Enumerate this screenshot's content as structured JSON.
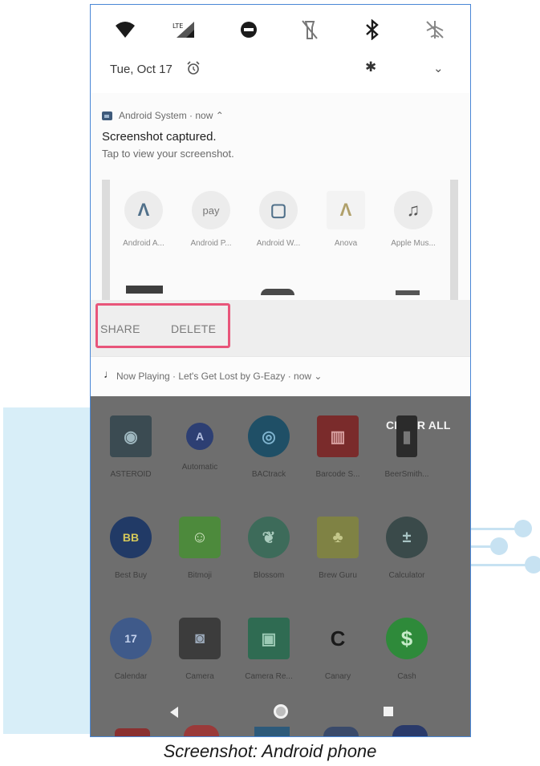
{
  "quick_settings": {
    "icons": [
      "wifi-icon",
      "lte-signal-icon",
      "do-not-disturb-icon",
      "flashlight-off-icon",
      "bluetooth-icon",
      "airplane-mode-off-icon"
    ],
    "lte_label": "LTE"
  },
  "date_row": {
    "date": "Tue, Oct 17",
    "alarm_icon": "alarm-icon",
    "settings_icon": "gear-icon",
    "expand_icon": "chevron-down-icon"
  },
  "notification": {
    "header": "Android System · now ⌃",
    "title": "Screenshot captured.",
    "subtitle": "Tap to view your screenshot.",
    "preview_apps": [
      {
        "label": "Android A...",
        "glyph": "Λ"
      },
      {
        "label": "Android P...",
        "glyph": "pay"
      },
      {
        "label": "Android W...",
        "glyph": "▢"
      },
      {
        "label": "Anova",
        "glyph": "Λ"
      },
      {
        "label": "Apple Mus...",
        "glyph": "♫"
      }
    ],
    "actions": {
      "share": "SHARE",
      "delete": "DELETE"
    }
  },
  "now_playing": {
    "text": "Now Playing · Let's Get Lost by G-Eazy · now ⌄"
  },
  "app_drawer": {
    "clear_all": "CLEAR ALL",
    "rows": [
      [
        {
          "label": "ASTEROID",
          "glyph": "◉",
          "color": "#3b4b52"
        },
        {
          "label": "Automatic",
          "glyph": "A",
          "color": "#2d3f73"
        },
        {
          "label": "BACtrack",
          "glyph": "◎",
          "color": "#1f4f66"
        },
        {
          "label": "Barcode S...",
          "glyph": "▥",
          "color": "#7a2b2b"
        },
        {
          "label": "BeerSmith...",
          "glyph": "▮",
          "color": "#2b2b2b"
        }
      ],
      [
        {
          "label": "Best Buy",
          "glyph": "BB",
          "color": "#213a66"
        },
        {
          "label": "Bitmoji",
          "glyph": "☺",
          "color": "#4d8a3c"
        },
        {
          "label": "Blossom",
          "glyph": "❦",
          "color": "#3d6b5a"
        },
        {
          "label": "Brew Guru",
          "glyph": "♣",
          "color": "#7f8244"
        },
        {
          "label": "Calculator",
          "glyph": "±",
          "color": "#3a4a4a"
        }
      ],
      [
        {
          "label": "Calendar",
          "glyph": "17",
          "color": "#3f5a8a"
        },
        {
          "label": "Camera",
          "glyph": "◙",
          "color": "#3c3c3c"
        },
        {
          "label": "Camera Re...",
          "glyph": "▣",
          "color": "#2f6b52"
        },
        {
          "label": "Canary",
          "glyph": "C",
          "color": "#6e6e6e"
        },
        {
          "label": "Cash",
          "glyph": "$",
          "color": "#2e8a3a"
        }
      ]
    ]
  },
  "navigation": {
    "back_icon": "back-icon",
    "home_icon": "home-icon",
    "recents_icon": "recents-icon"
  },
  "caption": "Screenshot: Android phone"
}
